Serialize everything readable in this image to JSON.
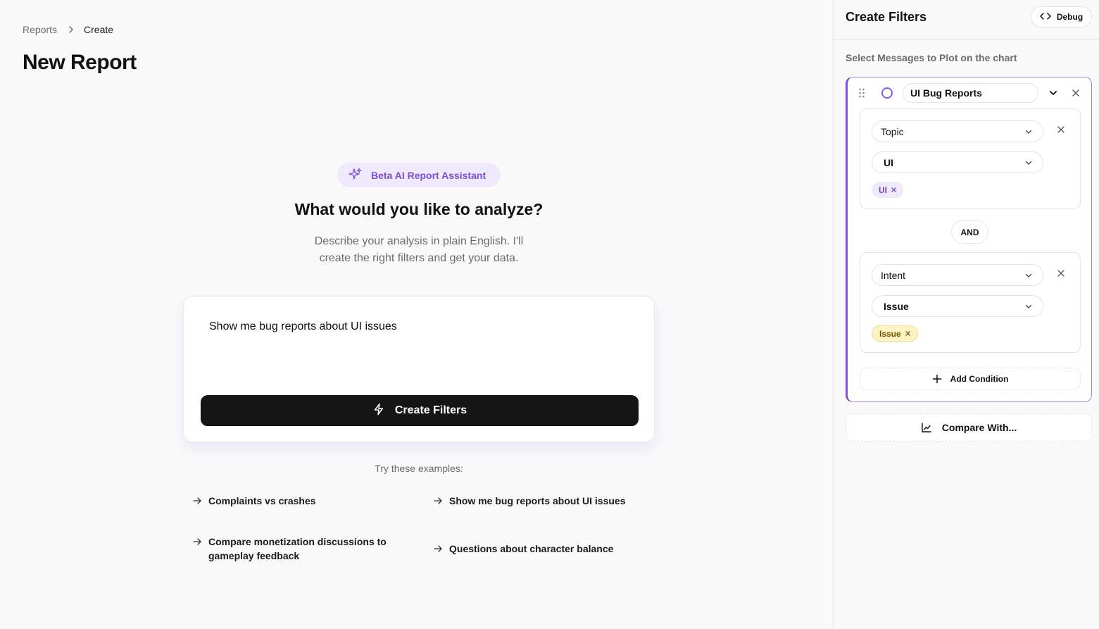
{
  "breadcrumb": {
    "parent": "Reports",
    "current": "Create"
  },
  "page": {
    "title": "New Report"
  },
  "assistant": {
    "badge": "Beta AI Report Assistant",
    "headline": "What would you like to analyze?",
    "subline_1": "Describe your analysis in plain English. I'll",
    "subline_2": "create the right filters and get your data.",
    "prompt_value": "Show me bug reports about UI issues",
    "create_button": "Create Filters",
    "examples_title": "Try these examples:",
    "examples": [
      {
        "line1": "Complaints vs crashes"
      },
      {
        "line1": "Show me bug reports about UI issues"
      },
      {
        "line1": "Compare monetization discussions to",
        "line2": "gameplay feedback"
      },
      {
        "line1": "Questions about character balance"
      }
    ]
  },
  "panel": {
    "title": "Create Filters",
    "debug_button": "Debug",
    "subtitle": "Select Messages to Plot on the chart",
    "series": {
      "name": "UI Bug Reports",
      "accent": "#7c4fd6",
      "conditions": [
        {
          "field": "Topic",
          "value": "UI",
          "chip": "UI",
          "chip_color": "purple"
        },
        {
          "field": "Intent",
          "value": "Issue",
          "chip": "Issue",
          "chip_color": "yellow"
        }
      ],
      "joiner": "AND",
      "add_condition": "Add Condition"
    },
    "compare_button": "Compare With..."
  }
}
